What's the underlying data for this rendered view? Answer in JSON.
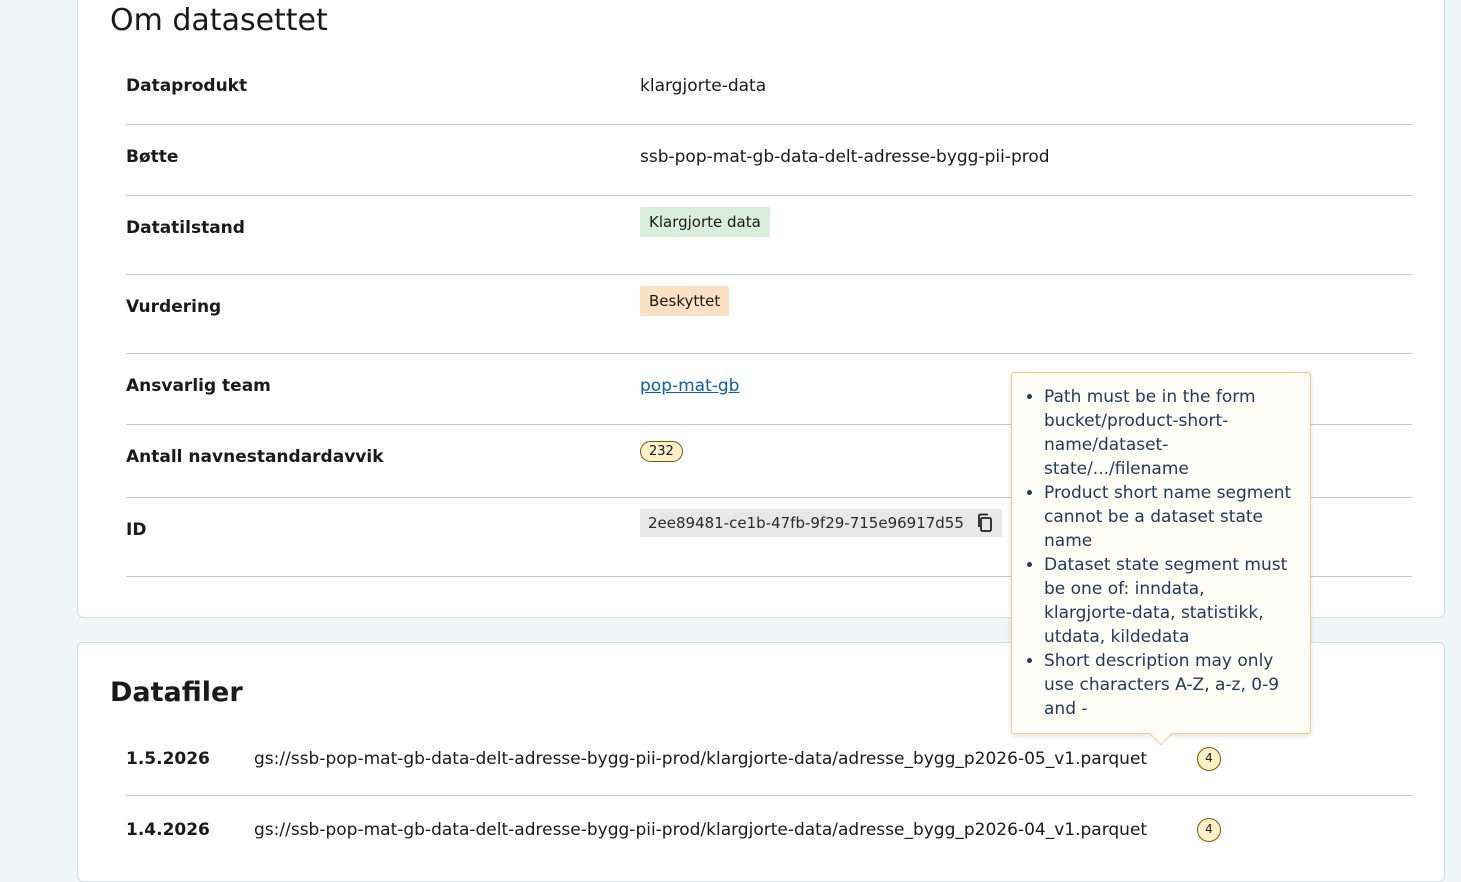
{
  "about": {
    "title": "Om datasettet",
    "dataprodukt": {
      "label": "Dataprodukt",
      "value": "klargjorte-data"
    },
    "botte": {
      "label": "Bøtte",
      "value": "ssb-pop-mat-gb-data-delt-adresse-bygg-pii-prod"
    },
    "datatilstand": {
      "label": "Datatilstand",
      "value": "Klargjorte data",
      "color": "#d9eedb"
    },
    "vurdering": {
      "label": "Vurdering",
      "value": "Beskyttet",
      "color": "#fbe0c3"
    },
    "team": {
      "label": "Ansvarlig team",
      "value": "pop-mat-gb"
    },
    "avvik": {
      "label": "Antall navnestandardavvik",
      "value": "232"
    },
    "id": {
      "label": "ID",
      "value": "2ee89481-ce1b-47fb-9f29-715e96917d55",
      "icon": "copy-icon"
    }
  },
  "tooltip": {
    "items": [
      "Path must be in the form bucket/product-short-name/dataset-state/.../filename",
      "Product short name segment cannot be a dataset state name",
      "Dataset state segment must be one of: inndata, klargjorte-data, statistikk, utdata, kildedata",
      "Short description may only use characters A-Z, a-z, 0-9 and -"
    ]
  },
  "files": {
    "title": "Datafiler",
    "rows": [
      {
        "date": "1.5.2026",
        "path": "gs://ssb-pop-mat-gb-data-delt-adresse-bygg-pii-prod/klargjorte-data/adresse_bygg_p2026-05_v1.parquet",
        "count": "4"
      },
      {
        "date": "1.4.2026",
        "path": "gs://ssb-pop-mat-gb-data-delt-adresse-bygg-pii-prod/klargjorte-data/adresse_bygg_p2026-04_v1.parquet",
        "count": "4"
      }
    ]
  },
  "colors": {
    "background": "#eef6f8",
    "link": "#0a5fb4",
    "tooltip_text": "#213a5c",
    "badge_border": "#7a5a00"
  }
}
